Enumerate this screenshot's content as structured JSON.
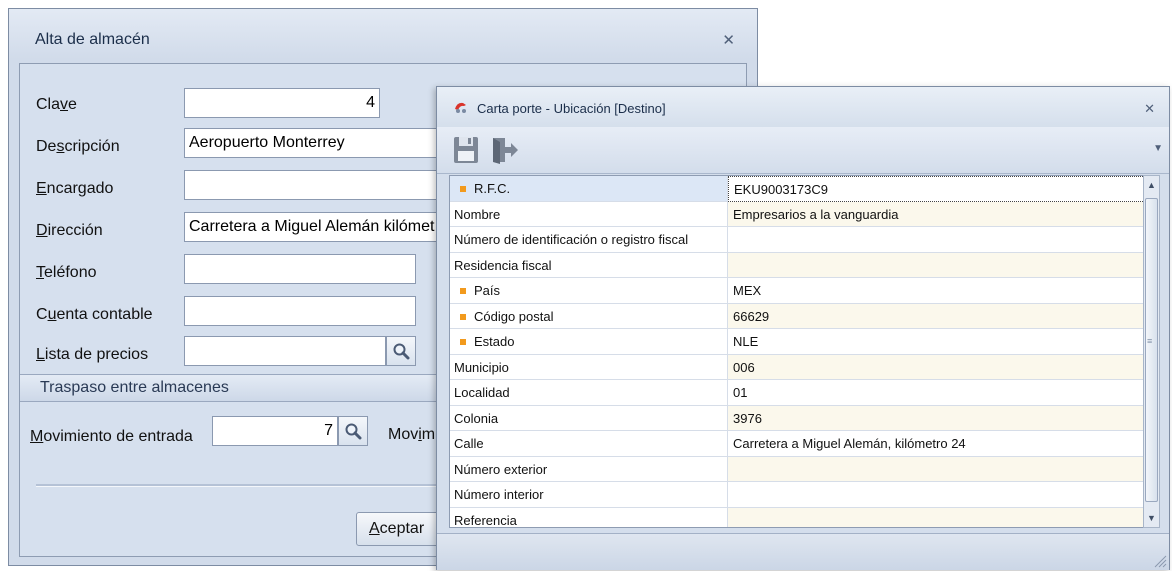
{
  "almacen": {
    "title": "Alta de almacén",
    "close": "✕",
    "labels": {
      "clave": [
        "Cla",
        "v",
        "e"
      ],
      "descripcion": [
        "De",
        "s",
        "cripción"
      ],
      "encargado": [
        "",
        "E",
        "ncargado"
      ],
      "direccion": [
        "",
        "D",
        "irección"
      ],
      "telefono": [
        "",
        "T",
        "eléfono"
      ],
      "cuenta": [
        "C",
        "u",
        "enta contable"
      ],
      "lista": [
        "",
        "L",
        "ista de precios"
      ],
      "mov_entrada": [
        "",
        "M",
        "ovimiento de entrada"
      ],
      "mov_salida": [
        "Mov",
        "i",
        "m"
      ]
    },
    "values": {
      "clave": "4",
      "descripcion": "Aeropuerto Monterrey",
      "encargado": "",
      "direccion": "Carretera a Miguel Alemán kilómet",
      "telefono": "",
      "cuenta": "",
      "lista": "",
      "mov_entrada": "7"
    },
    "group_title": "Traspaso entre almacenes",
    "accept_label": [
      "",
      "A",
      "ceptar"
    ]
  },
  "carta_porte": {
    "title": "Carta porte - Ubicación [Destino]",
    "close": "✕",
    "toolbar": {
      "save_icon": "save-icon",
      "exit_icon": "exit-icon",
      "more": "▼"
    },
    "rows": [
      {
        "label": "R.F.C.",
        "value": "EKU9003173C9",
        "required": true
      },
      {
        "label": "Nombre",
        "value": "Empresarios a la vanguardia",
        "required": false
      },
      {
        "label": "Número de identificación o registro fiscal",
        "value": "",
        "required": false
      },
      {
        "label": "Residencia fiscal",
        "value": "",
        "required": false
      },
      {
        "label": "País",
        "value": "MEX",
        "required": true
      },
      {
        "label": "Código postal",
        "value": "66629",
        "required": true
      },
      {
        "label": "Estado",
        "value": "NLE",
        "required": true
      },
      {
        "label": "Municipio",
        "value": "006",
        "required": false
      },
      {
        "label": "Localidad",
        "value": "01",
        "required": false
      },
      {
        "label": "Colonia",
        "value": "3976",
        "required": false
      },
      {
        "label": "Calle",
        "value": "Carretera a Miguel Alemán, kilómetro 24",
        "required": false
      },
      {
        "label": "Número exterior",
        "value": "",
        "required": false
      },
      {
        "label": "Número interior",
        "value": "",
        "required": false
      },
      {
        "label": "Referencia",
        "value": "",
        "required": false
      }
    ],
    "required_color": "#f29a1d"
  }
}
